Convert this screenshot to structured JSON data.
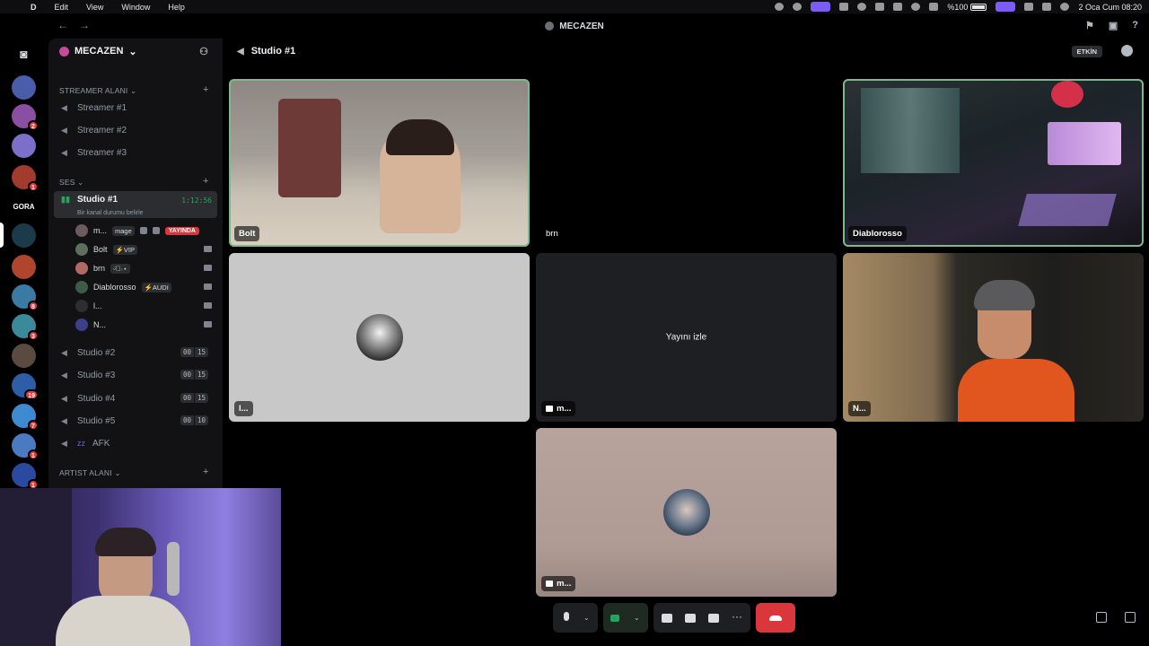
{
  "menubar": {
    "app_name": "D",
    "menus": [
      "Edit",
      "View",
      "Window",
      "Help"
    ],
    "battery": "%100",
    "datetime": "2 Oca Cum  08:20"
  },
  "titlebar": {
    "title": "MECAZEN"
  },
  "rail": {
    "servers": [
      {
        "label": "",
        "badge": ""
      },
      {
        "label": "",
        "badge": "2"
      },
      {
        "label": "",
        "badge": ""
      },
      {
        "label": "",
        "badge": "1"
      },
      {
        "label": "GORA",
        "badge": ""
      },
      {
        "label": "",
        "badge": ""
      },
      {
        "label": "",
        "badge": ""
      },
      {
        "label": "",
        "badge": "8"
      },
      {
        "label": "",
        "badge": "3"
      },
      {
        "label": "",
        "badge": ""
      },
      {
        "label": "",
        "badge": "19"
      },
      {
        "label": "",
        "badge": "7"
      },
      {
        "label": "",
        "badge": "1"
      },
      {
        "label": "",
        "badge": "1"
      }
    ]
  },
  "sidebar": {
    "server_name": "MECAZEN",
    "categories": {
      "streamer": "STREAMER ALANI",
      "ses": "SES",
      "artist": "ARTIST ALANI"
    },
    "streamer_channels": [
      "Streamer #1",
      "Streamer #2",
      "Streamer #3"
    ],
    "active_channel": {
      "name": "Studio #1",
      "timer": "1:12:56",
      "status": "Bir kanal durumu belirle"
    },
    "members": [
      {
        "name": "m...",
        "tag": "mage",
        "live": "YAYINDA"
      },
      {
        "name": "Bolt",
        "tag": "⚡VIP",
        "live": ""
      },
      {
        "name": "brn",
        "tag": "ᵕ̈⃝·⋆",
        "live": ""
      },
      {
        "name": "Diablorosso",
        "tag": "⚡AUDI",
        "live": ""
      },
      {
        "name": "l...",
        "tag": "",
        "live": ""
      },
      {
        "name": "N...",
        "tag": "",
        "live": ""
      }
    ],
    "other_channels": [
      {
        "name": "Studio #2",
        "count": "00",
        "limit": "15"
      },
      {
        "name": "Studio #3",
        "count": "00",
        "limit": "15"
      },
      {
        "name": "Studio #4",
        "count": "00",
        "limit": "15"
      },
      {
        "name": "Studio #5",
        "count": "00",
        "limit": "10"
      }
    ],
    "afk_channel": "AFK"
  },
  "main": {
    "channel_title": "Studio #1",
    "activity_badge": "ETKİN",
    "tiles": [
      {
        "name": "Bolt"
      },
      {
        "name": "brn"
      },
      {
        "name": "Diablorosso"
      },
      {
        "name": "l..."
      },
      {
        "name": "m..."
      },
      {
        "name": "N..."
      },
      {
        "name": "m..."
      }
    ],
    "watch_stream_label": "Yayını izle"
  },
  "colors": {
    "speaking_border": "#7fb88f",
    "hangup": "#da373c",
    "active_green": "#23a55a",
    "live_red": "#da373c"
  }
}
